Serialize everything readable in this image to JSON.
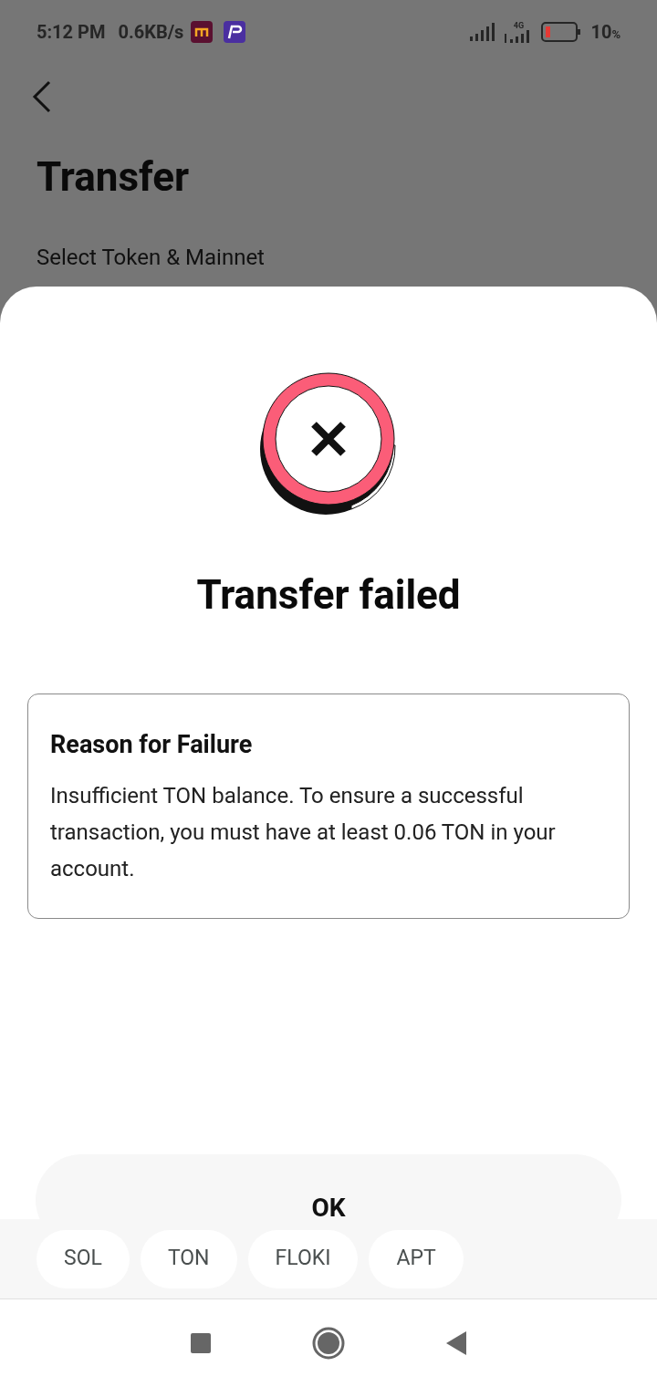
{
  "status_bar": {
    "time": "5:12 PM",
    "speed": "0.6KB/s",
    "network": "4G",
    "battery": "10",
    "battery_unit": "%"
  },
  "page": {
    "title": "Transfer",
    "subtitle": "Select Token & Mainnet"
  },
  "dialog": {
    "title": "Transfer failed",
    "reason_title": "Reason for Failure",
    "reason_text": "Insufficient TON balance. To ensure a successful transaction, you must have at least 0.06 TON in your account.",
    "button": "OK"
  },
  "suggestions": [
    "SOL",
    "TON",
    "FLOKI",
    "APT"
  ]
}
